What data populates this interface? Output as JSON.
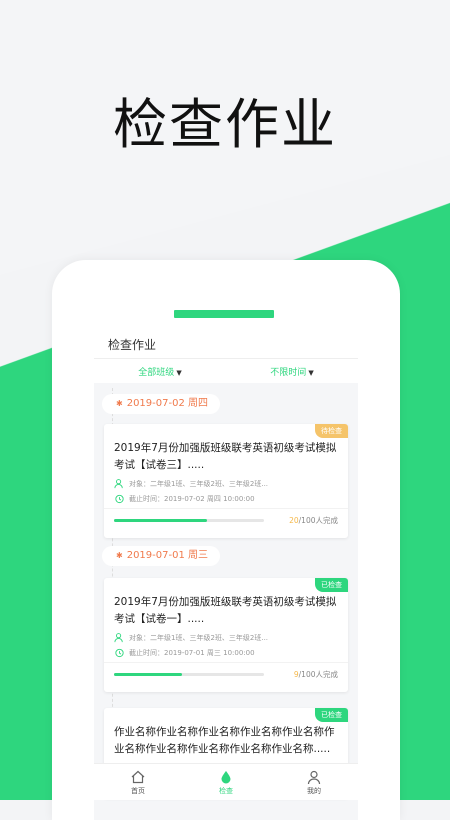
{
  "headline": "检查作业",
  "app": {
    "title": "检查作业",
    "filters": {
      "class": "全部班级",
      "time": "不限时间"
    },
    "groups": [
      {
        "date": "2019-07-02 周四",
        "card": {
          "status": "待检查",
          "title": "2019年7月份加强版班级联考英语初级考试模拟考试【试卷三】.....",
          "target": "对象：二年级1班、三年级2班、三年级2班...",
          "deadline": "截止时间：2019-07-02  周四 10:00:00",
          "done": "20",
          "total": "/100人完成",
          "progress": 0.62
        }
      },
      {
        "date": "2019-07-01 周三",
        "card": {
          "status": "已检查",
          "title": "2019年7月份加强版班级联考英语初级考试模拟考试【试卷一】.....",
          "target": "对象：二年级1班、三年级2班、三年级2班...",
          "deadline": "截止时间：2019-07-01  周三 10:00:00",
          "done": "9",
          "total": "/100人完成",
          "progress": 0.45
        }
      }
    ],
    "extra_card": {
      "status": "已检查",
      "title": "作业名称作业名称作业名称作业名称作业名称作业名称作业名称作业名称作业名称作业名称....."
    },
    "tabs": {
      "home": "首页",
      "check": "检查",
      "mine": "我的"
    },
    "colors": {
      "accent": "#2ed67e",
      "date": "#f07a4c",
      "pending": "#f5c46a"
    }
  }
}
